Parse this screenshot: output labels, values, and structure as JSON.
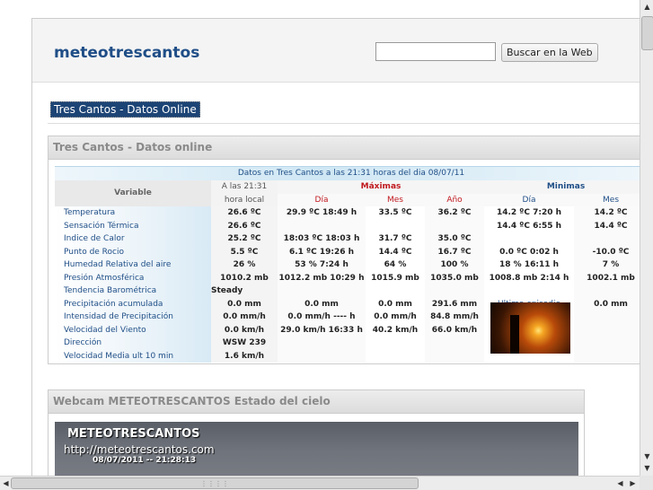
{
  "header": {
    "site_title": "meteotrescantos",
    "search_placeholder": "",
    "search_button": "Buscar en la Web"
  },
  "site_link": "Tres Cantos - Datos Online",
  "panel_online": {
    "title": "Tres Cantos - Datos online",
    "caption": "Datos en Tres Cantos a las 21:31 horas del dia 08/07/11",
    "headers": {
      "variable": "Variable",
      "now_line1": "A las 21:31",
      "now_line2": "hora local",
      "maximas": "Máximas",
      "minimas": "Minimas",
      "dia": "Día",
      "mes": "Mes",
      "anio": "Año",
      "min_dia": "Día",
      "min_mes": "Mes"
    },
    "rows": [
      {
        "name": "Temperatura",
        "now": "26.6 ºC",
        "max_dia": "29.9 ºC 18:49 h",
        "max_mes": "33.5 ºC",
        "max_anio": "36.2 ºC",
        "min_dia": "14.2 ºC 7:20 h",
        "min_mes": "14.2 ºC"
      },
      {
        "name": "Sensación Térmica",
        "now": "26.6 ºC",
        "max_dia": "",
        "max_mes": "",
        "max_anio": "",
        "min_dia": "14.4 ºC 6:55 h",
        "min_mes": "14.4 ºC"
      },
      {
        "name": "Indice de Calor",
        "now": "25.2 ºC",
        "max_dia": "18:03 ºC 18:03 h",
        "max_mes": "31.7 ºC",
        "max_anio": "35.0 ºC",
        "min_dia": "",
        "min_mes": ""
      },
      {
        "name": "Punto de Rocio",
        "now": "5.5 ºC",
        "max_dia": "6.1 ºC 19:26 h",
        "max_mes": "14.4 ºC",
        "max_anio": "16.7 ºC",
        "min_dia": "0.0 ºC 0:02 h",
        "min_mes": "-10.0 ºC"
      },
      {
        "name": "Humedad Relativa del aire",
        "now": "26 %",
        "max_dia": "53 % 7:24 h",
        "max_mes": "64 %",
        "max_anio": "100 %",
        "min_dia": "18 % 16:11 h",
        "min_mes": "7 %"
      },
      {
        "name": "Presión Atmosférica",
        "now": "1010.2 mb",
        "max_dia": "1012.2 mb 10:29 h",
        "max_mes": "1015.9 mb",
        "max_anio": "1035.0 mb",
        "min_dia": "1008.8 mb 2:14 h",
        "min_mes": "1002.1 mb"
      },
      {
        "name": "Tendencia Barométrica",
        "now": "Steady",
        "max_dia": "",
        "max_mes": "",
        "max_anio": "",
        "min_dia": "",
        "min_mes": ""
      },
      {
        "name": "Precipitación acumulada",
        "now": "0.0 mm",
        "max_dia": "0.0 mm",
        "max_mes": "0.0 mm",
        "max_anio": "291.6 mm",
        "min_dia": "Ultimo episodio",
        "min_mes": "0.0 mm"
      },
      {
        "name": "Intensidad de Precipitación",
        "now": "0.0 mm/h",
        "max_dia": "0.0 mm/h ---- h",
        "max_mes": "0.0 mm/h",
        "max_anio": "84.8 mm/h",
        "min_dia": "",
        "min_mes": ""
      },
      {
        "name": "Velocidad del Viento",
        "now": "0.0 km/h",
        "max_dia": "29.0 km/h 16:33 h",
        "max_mes": "40.2 km/h",
        "max_anio": "66.0 km/h",
        "min_dia": "",
        "min_mes": ""
      },
      {
        "name": "Dirección",
        "now": "WSW 239",
        "max_dia": "",
        "max_mes": "",
        "max_anio": "",
        "min_dia": "",
        "min_mes": ""
      },
      {
        "name": "Velocidad Media ult 10 min",
        "now": "1.6 km/h",
        "max_dia": "",
        "max_mes": "",
        "max_anio": "",
        "min_dia": "",
        "min_mes": ""
      }
    ]
  },
  "panel_webcam": {
    "title": "Webcam METEOTRESCANTOS Estado del cielo",
    "overlay_title": "METEOTRESCANTOS",
    "overlay_url": "http://meteotrescantos.com",
    "overlay_time": "08/07/2011 -- 21:28:13"
  },
  "scrollbars": {
    "up_icon": "▲",
    "down_icon": "▼",
    "left_icon": "◀",
    "right_icon": "▶",
    "grip": "⋮⋮⋮⋮"
  },
  "colors": {
    "brand": "#1f4e87",
    "max_red": "#c0181e",
    "link_bg": "#1c4475"
  }
}
